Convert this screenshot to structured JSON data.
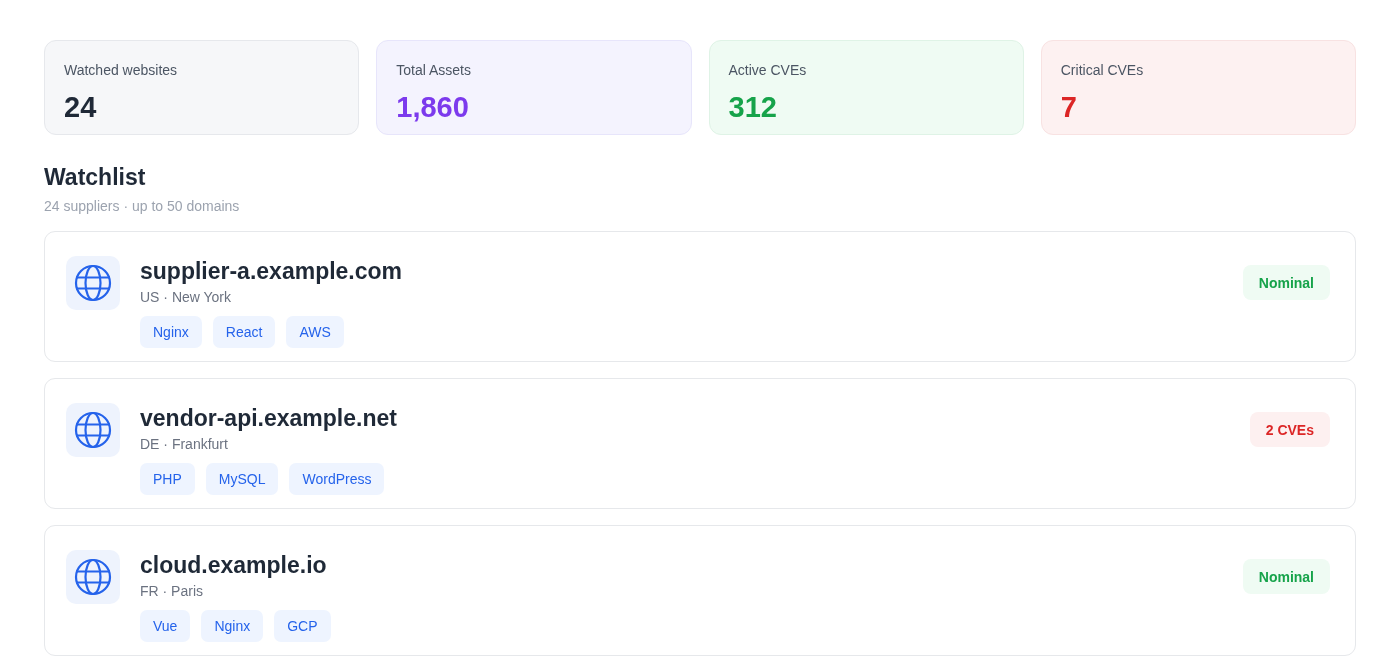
{
  "stats": [
    {
      "label": "Watched websites",
      "value": "24",
      "kind": "neutral"
    },
    {
      "label": "Total Assets",
      "value": "1,860",
      "kind": "assets"
    },
    {
      "label": "Active CVEs",
      "value": "312",
      "kind": "active"
    },
    {
      "label": "Critical CVEs",
      "value": "7",
      "kind": "critical"
    }
  ],
  "watchlist": {
    "title": "Watchlist",
    "subtitle": "24 suppliers · up to 50 domains",
    "sites": [
      {
        "domain": "supplier-a.example.com",
        "location": "US · New York",
        "tags": [
          "Nginx",
          "React",
          "AWS"
        ],
        "status": {
          "label": "Nominal",
          "kind": "ok"
        }
      },
      {
        "domain": "vendor-api.example.net",
        "location": "DE · Frankfurt",
        "tags": [
          "PHP",
          "MySQL",
          "WordPress"
        ],
        "status": {
          "label": "2 CVEs",
          "kind": "alert"
        }
      },
      {
        "domain": "cloud.example.io",
        "location": "FR · Paris",
        "tags": [
          "Vue",
          "Nginx",
          "GCP"
        ],
        "status": {
          "label": "Nominal",
          "kind": "ok"
        }
      }
    ]
  }
}
